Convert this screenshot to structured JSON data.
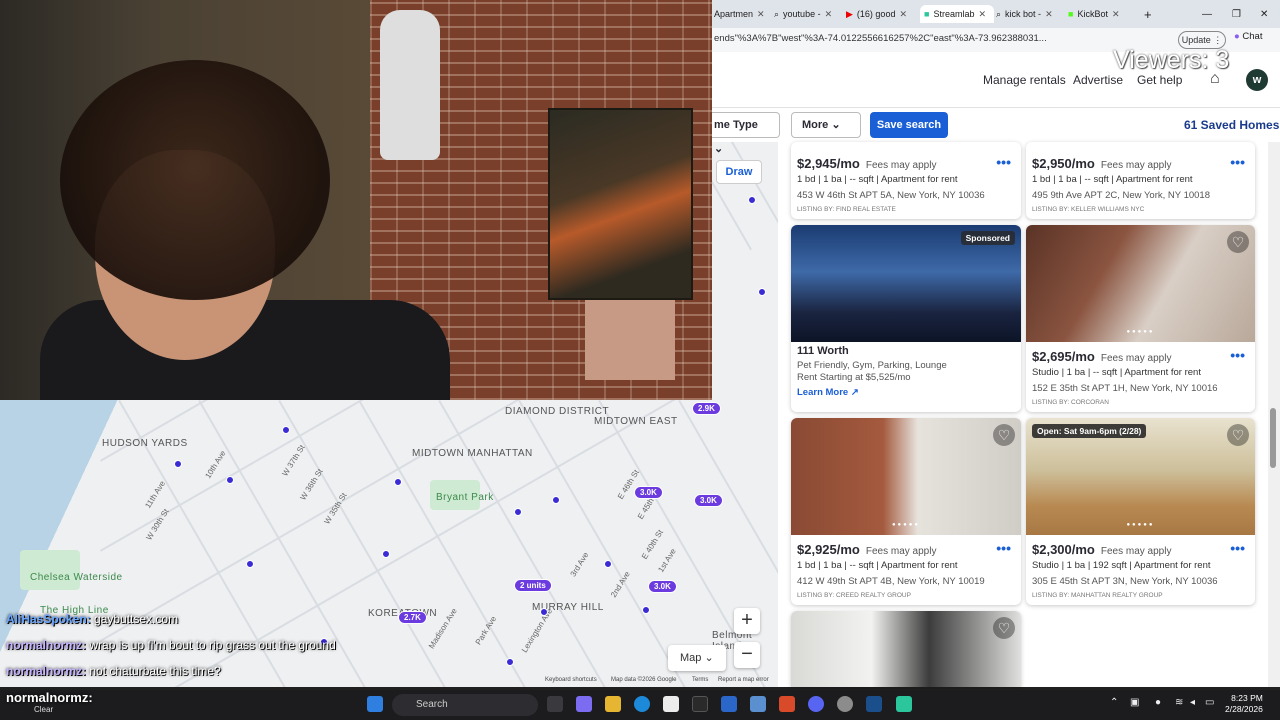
{
  "browser": {
    "tabs": [
      {
        "label": "Apartmen",
        "icon": "zillow-icon"
      },
      {
        "label": "youtube -",
        "icon": "search-icon"
      },
      {
        "label": "(16) good",
        "icon": "youtube-icon"
      },
      {
        "label": "Streamlab",
        "icon": "streamlabs-icon"
      },
      {
        "label": "kick bot -",
        "icon": "search-icon"
      },
      {
        "label": "KickBot",
        "icon": "kickbot-icon"
      }
    ],
    "url": "ends\"%3A%7B\"west\"%3A-74.0122556616257%2C\"east\"%3A-73.962388031...",
    "update_label": "Update",
    "chat_label": "Chat"
  },
  "stream": {
    "viewers": "Viewers: 3",
    "streamer_name": "normalnormz:",
    "clear_label": "Clear",
    "chat": [
      {
        "user": "AliHasSpoken:",
        "message": "gaybuttsex.com"
      },
      {
        "user": "normalnormz:",
        "message": "wrap is up fi'm bout to rip grass out the ground"
      },
      {
        "user": "normalnormz:",
        "message": "not chaturbate this time?"
      }
    ]
  },
  "site": {
    "nav": [
      "Manage rentals",
      "Advertise",
      "Get help"
    ],
    "avatar_letter": "w",
    "filters": {
      "home_type": "me Type",
      "more": "More",
      "save_search": "Save search",
      "saved_homes": "61 Saved Homes"
    },
    "draw_label": "Draw"
  },
  "map": {
    "areas": [
      "HUDSON YARDS",
      "DIAMOND DISTRICT",
      "MIDTOWN EAST",
      "MIDTOWN MANHATTAN",
      "Bryant Park",
      "KOREATOWN",
      "MURRAY HILL",
      "Chelsea Waterside",
      "The High Line",
      "Belmont Island"
    ],
    "streets": [
      "11th Ave",
      "10th Ave",
      "W 37th St",
      "W 36th St",
      "W 35th St",
      "W 30th St",
      "E 46th St",
      "E 45th St",
      "E 40th St",
      "Park Ave",
      "Madison Ave",
      "Lexington Ave",
      "3rd Ave",
      "2nd Ave",
      "1st Ave"
    ],
    "price_badges": [
      "2.9K",
      "3.0K",
      "3.0K",
      "3.0K",
      "2.7K",
      "2 units"
    ],
    "map_type": "Map",
    "attribution": [
      "Keyboard shortcuts",
      "Map data ©2026 Google",
      "Terms",
      "Report a map error"
    ]
  },
  "listings": [
    {
      "price": "$2,945/mo",
      "fee": "Fees may apply",
      "details": "1 bd | 1 ba | -- sqft | Apartment for rent",
      "address": "453 W 46th St APT 5A, New York, NY 10036",
      "listing_by": "LISTING BY: FIND REAL ESTATE"
    },
    {
      "price": "$2,950/mo",
      "fee": "Fees may apply",
      "details": "1 bd | 1 ba | -- sqft | Apartment for rent",
      "address": "495 9th Ave APT 2C, New York, NY 10018",
      "listing_by": "LISTING BY: KELLER WILLIAMS NYC"
    },
    {
      "sponsored": "Sponsored",
      "name": "111 Worth",
      "details": "Pet Friendly, Gym, Parking, Lounge",
      "rent": "Rent Starting at $5,525/mo",
      "link": "Learn More"
    },
    {
      "price": "$2,695/mo",
      "fee": "Fees may apply",
      "details": "Studio | 1 ba | -- sqft | Apartment for rent",
      "address": "152 E 35th St APT 1H, New York, NY 10016",
      "listing_by": "LISTING BY: CORCORAN"
    },
    {
      "price": "$2,925/mo",
      "fee": "Fees may apply",
      "details": "1 bd | 1 ba | -- sqft | Apartment for rent",
      "address": "412 W 49th St APT 4B, New York, NY 10019",
      "listing_by": "LISTING BY: CREED REALTY GROUP"
    },
    {
      "badge": "Open: Sat 9am-6pm (2/28)",
      "price": "$2,300/mo",
      "fee": "Fees may apply",
      "details": "Studio | 1 ba | 192 sqft | Apartment for rent",
      "address": "305 E 45th St APT 3N, New York, NY 10036",
      "listing_by": "LISTING BY: MANHATTAN REALTY GROUP"
    }
  ],
  "taskbar": {
    "search": "Search",
    "time": "8:23 PM",
    "date": "2/28/2026"
  }
}
